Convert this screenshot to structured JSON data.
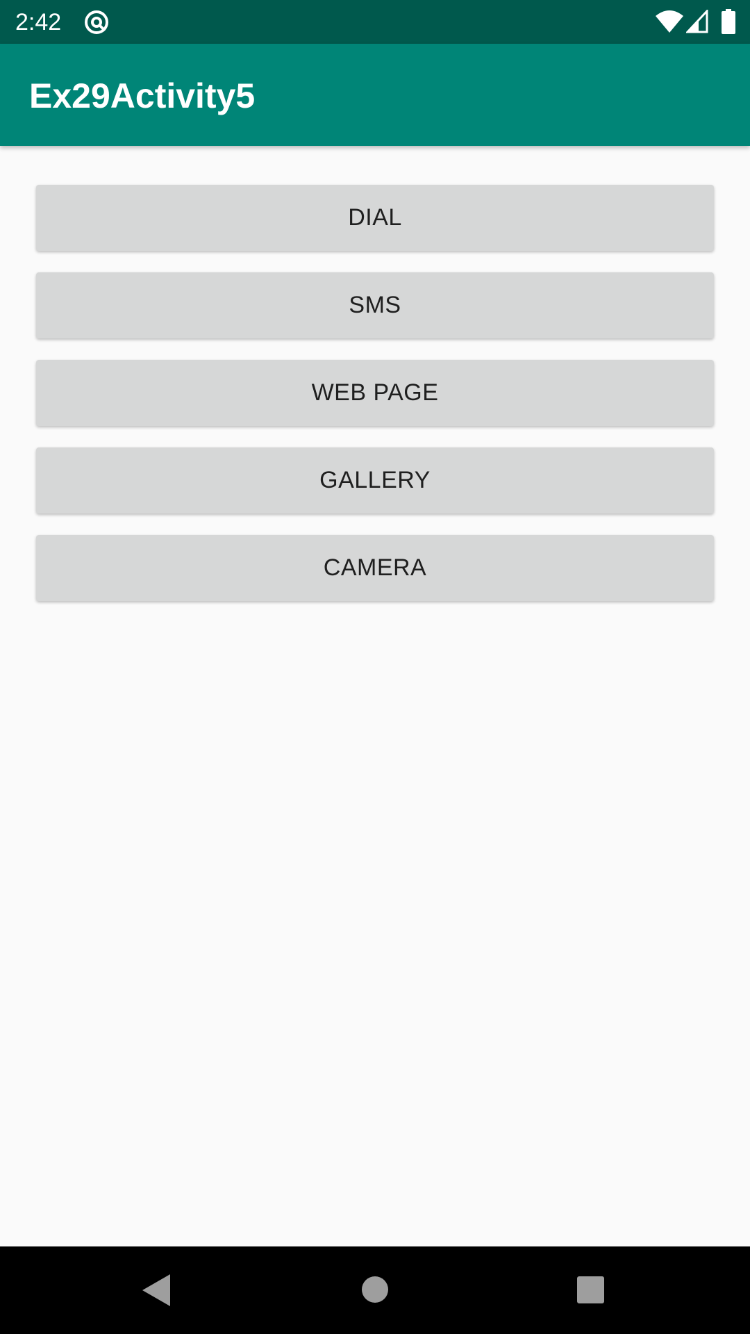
{
  "status_bar": {
    "time": "2:42",
    "icons": [
      "vpn-key-icon",
      "wifi-icon",
      "cell-signal-icon",
      "battery-icon"
    ],
    "background": "#00594d"
  },
  "app_bar": {
    "title": "Ex29Activity5",
    "background": "#008577"
  },
  "buttons": [
    {
      "label": "DIAL"
    },
    {
      "label": "SMS"
    },
    {
      "label": "WEB PAGE"
    },
    {
      "label": "GALLERY"
    },
    {
      "label": "CAMERA"
    }
  ],
  "nav_bar": {
    "icons": [
      "back-icon",
      "home-icon",
      "recents-icon"
    ]
  },
  "colors": {
    "button_bg": "#d6d7d7",
    "button_text": "#1f1f1f",
    "page_bg": "#fafafa"
  }
}
